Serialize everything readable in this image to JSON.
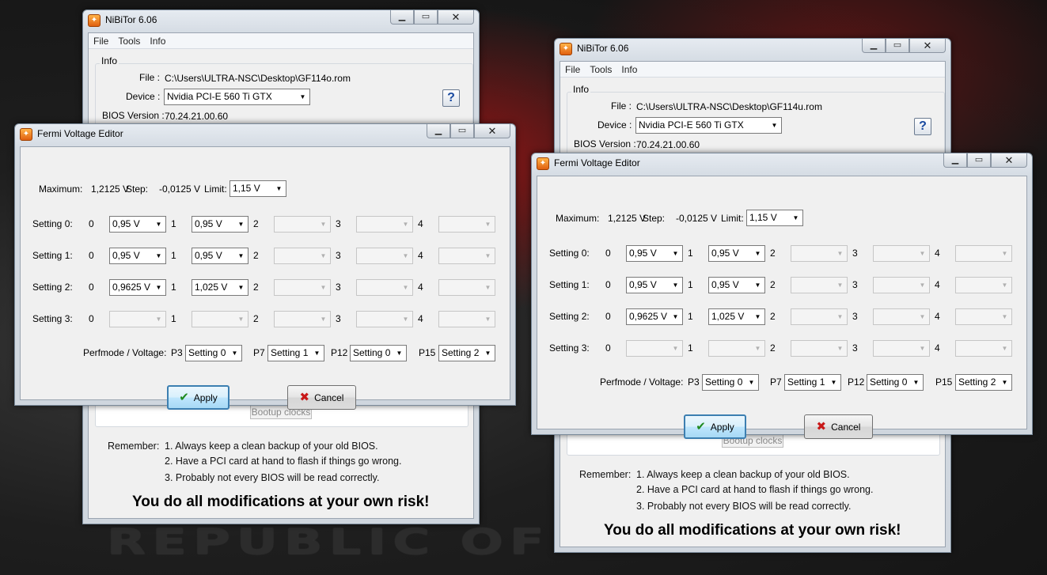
{
  "background": {
    "text": "REPUBLIC OF"
  },
  "nibitor": {
    "title": "NiBiTor 6.06",
    "menu": [
      "File",
      "Tools",
      "Info"
    ],
    "info_label": "Info",
    "file_label": "File :",
    "device_label": "Device :",
    "device_value": "Nvidia PCI-E 560 Ti GTX",
    "bios_label": "BIOS Version :",
    "bios_value": "70.24.21.00.60",
    "help": "?",
    "bootup_button": "Bootup clocks",
    "remember_label": "Remember:",
    "remember_1": "1. Always keep a clean backup of your old BIOS.",
    "remember_2": "2. Have a PCI card at hand to flash if things go wrong.",
    "remember_3": "3. Probably not every BIOS will be read correctly.",
    "warning": "You do all modifications at your own risk!"
  },
  "left_file": "C:\\Users\\ULTRA-NSC\\Desktop\\GF114o.rom",
  "right_file": "C:\\Users\\ULTRA-NSC\\Desktop\\GF114u.rom",
  "fermi": {
    "title": "Fermi Voltage Editor",
    "maximum_label": "Maximum:",
    "maximum_value": "1,2125 V",
    "step_label": "Step:",
    "step_value": "-0,0125 V",
    "limit_label": "Limit:",
    "limit_value": "1,15 V",
    "idx": [
      "0",
      "1",
      "2",
      "3",
      "4"
    ],
    "settings": [
      {
        "label": "Setting 0:",
        "values": [
          "0,95 V",
          "0,95 V",
          "",
          "",
          ""
        ]
      },
      {
        "label": "Setting 1:",
        "values": [
          "0,95 V",
          "0,95 V",
          "",
          "",
          ""
        ]
      },
      {
        "label": "Setting 2:",
        "values": [
          "0,9625 V",
          "1,025 V",
          "",
          "",
          ""
        ]
      },
      {
        "label": "Setting 3:",
        "values": [
          "",
          "",
          "",
          "",
          ""
        ]
      }
    ],
    "perf_label": "Perfmode / Voltage:",
    "perf": [
      {
        "label": "P3",
        "value": "Setting 0"
      },
      {
        "label": "P7",
        "value": "Setting 1"
      },
      {
        "label": "P12",
        "value": "Setting 0"
      },
      {
        "label": "P15",
        "value": "Setting 2"
      }
    ],
    "apply": "Apply",
    "cancel": "Cancel"
  },
  "icons": {
    "app": "nibitor-app-icon",
    "minimize": "minimize-icon",
    "maximize": "maximize-icon",
    "close": "close-icon",
    "apply": "checkmark-icon",
    "cancel": "cross-icon",
    "dropdown": "chevron-down-icon",
    "help": "help-icon"
  }
}
